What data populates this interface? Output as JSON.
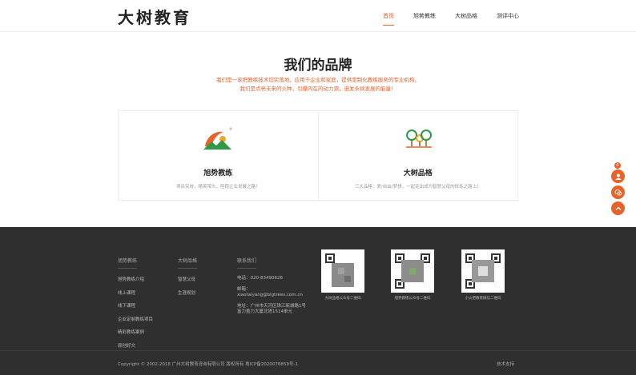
{
  "header": {
    "logo": "大树教育",
    "nav": [
      "首页",
      "旭势教练",
      "大树品格",
      "测评中心"
    ]
  },
  "brand": {
    "title": "我们的品牌",
    "desc_line1": "我们是一家把教练技术切实落地，应用于企业和家庭，提供定制化教练服务的专业机构。",
    "desc_line2": "我们是点亮未来的火种，引爆内在的动力源，迸发永续发展的能量！",
    "cards": [
      {
        "title": "旭势教练",
        "desc": "项目实效，精英带头，陪跑企业发展之路！"
      },
      {
        "title": "大树品格",
        "desc": "三大品格：爱/自由/梦想，一起走出成为智慧父母的修炼之路上！"
      }
    ]
  },
  "side": {
    "badge": "0"
  },
  "footer": {
    "col1": {
      "title": "旭势教练",
      "links": [
        "旭势教练介绍",
        "线上课程",
        "线下课程",
        "企业定制教练项目",
        "精彩教练案例",
        "原创好文"
      ]
    },
    "col2": {
      "title": "大树品格",
      "links": [
        "智慧父母",
        "生涯规划"
      ]
    },
    "col3": {
      "title": "联系我们",
      "phone": "电话：020-83490626",
      "email_label": "邮箱：",
      "email": "xiaotaiyang@bigtrees.com.cn",
      "address": "地址：广州市天河区珠江新城路1号富力盈力大厦北塔1514单元"
    },
    "qrs": [
      "大树品格公众号二维码",
      "旭势教练公众号二维码",
      "小火把教练微信二维码"
    ],
    "copyright": "Copyright © 2002-2018 广州大树教育咨询有限公司 版权所有 粤ICP备2020076859号-1",
    "tech": "技术支持"
  },
  "colors": {
    "accent": "#e8622a",
    "footer_bg": "#2f2f2f"
  }
}
